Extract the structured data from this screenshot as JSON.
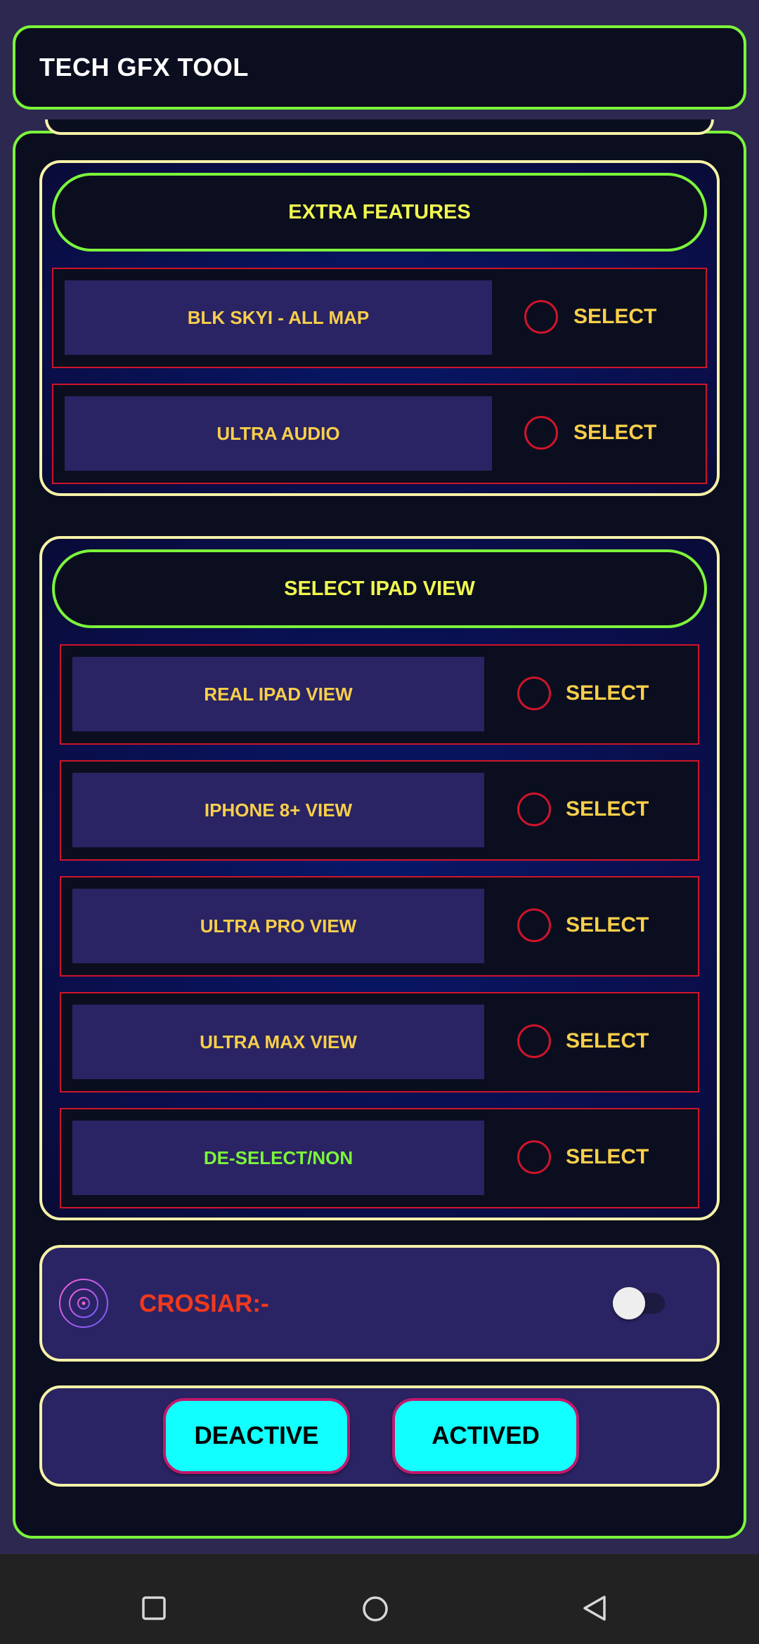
{
  "header": {
    "title": "TECH GFX TOOL"
  },
  "extra_features": {
    "title": "EXTRA FEATURES",
    "options": [
      {
        "label": "BLK SKYI - ALL MAP",
        "select_label": "SELECT"
      },
      {
        "label": "ULTRA AUDIO",
        "select_label": "SELECT"
      }
    ]
  },
  "ipad_view": {
    "title": "SELECT IPAD VIEW",
    "options": [
      {
        "label": "REAL IPAD VIEW",
        "select_label": "SELECT"
      },
      {
        "label": "IPHONE 8+ VIEW",
        "select_label": "SELECT"
      },
      {
        "label": "ULTRA PRO VIEW",
        "select_label": "SELECT"
      },
      {
        "label": "ULTRA MAX VIEW",
        "select_label": "SELECT"
      },
      {
        "label": "DE-SELECT/NON",
        "select_label": "SELECT"
      }
    ]
  },
  "crosshair": {
    "label": "CROSIAR:-",
    "icon": "crosshair-icon",
    "toggle_on": false
  },
  "actions": {
    "deactive_label": "DEACTIVE",
    "actived_label": "ACTIVED"
  },
  "navbar": {
    "recents_icon": "square-icon",
    "home_icon": "circle-icon",
    "back_icon": "triangle-back-icon"
  },
  "colors": {
    "accent_green": "#7cf53a",
    "panel_yellow": "#f6f1a8",
    "label_gold": "#f9cf4a",
    "radio_red": "#d0142b",
    "button_cyan": "#12ffff",
    "crosshair_red": "#f2391d"
  }
}
